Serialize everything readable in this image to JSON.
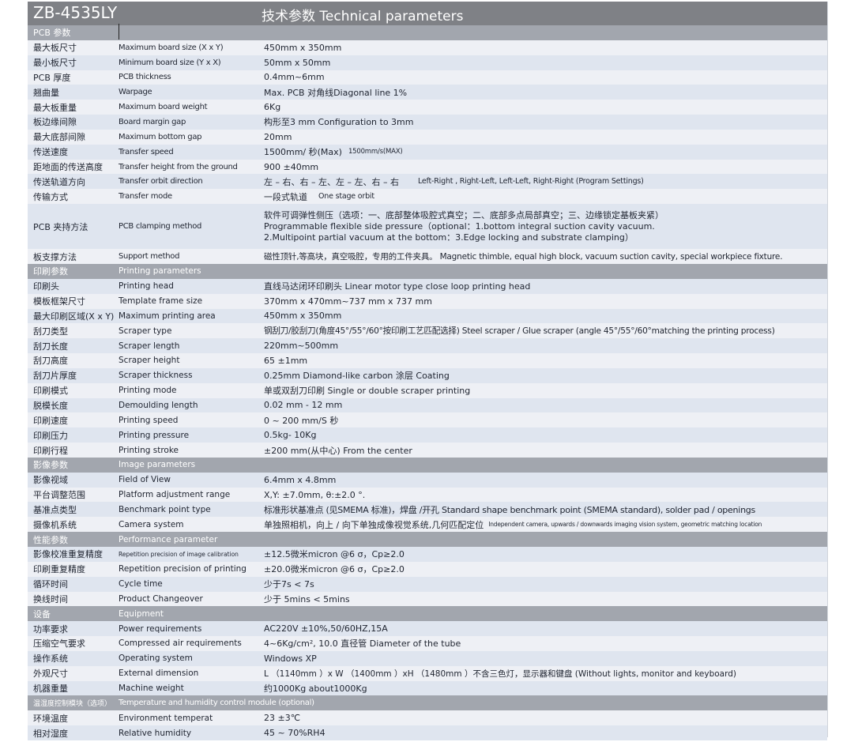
{
  "header": {
    "model": "ZB-4535LY",
    "title": "技术参数  Technical parameters"
  },
  "sections": [
    {
      "label_cn": "PCB 参数",
      "label_en": "",
      "rows": [
        {
          "cn": "最大板尺寸",
          "en": "Maximum board size (X x Y)",
          "value": "450mm x 350mm"
        },
        {
          "cn": "最小板尺寸",
          "en": "Minimum board size (Y x X)",
          "value": "50mm x 50mm"
        },
        {
          "cn": "PCB 厚度",
          "en": "PCB thickness",
          "value": "0.4mm~6mm"
        },
        {
          "cn": "翘曲量",
          "en": "Warpage",
          "value": "Max. PCB  对角线Diagonal line 1%"
        },
        {
          "cn": "最大板重量",
          "en": "Maximum board weight",
          "value": "6Kg"
        },
        {
          "cn": "板边缘间隙",
          "en": "Board margin gap",
          "value": "构形至3 mm  Configuration to 3mm"
        },
        {
          "cn": "最大底部间隙",
          "en": "Maximum bottom gap",
          "value": "20mm"
        },
        {
          "cn": "传送速度",
          "en": "Transfer speed",
          "value": "1500mm/ 秒(Max)",
          "note": "1500mm/s(MAX)"
        },
        {
          "cn": "距地面的传送高度",
          "en": "Transfer height from the ground",
          "value": "900 ±40mm"
        },
        {
          "cn": "传送轨道方向",
          "en": "Transfer orbit direction",
          "value": "左 – 右、右 – 左、左 – 左、右 – 右",
          "note": "Left-Right , Right-Left, Left-Left, Right-Right (Program Settings)"
        },
        {
          "cn": "传输方式",
          "en": "Transfer mode",
          "value": "一段式轨道",
          "note": "One stage orbit"
        },
        {
          "cn": "PCB 夹持方法",
          "en": "PCB clamping method",
          "lines": [
            "软件可调弹性侧压（选项：一、底部整体吸腔式真空；二、底部多点局部真空；三、边缘锁定基板夹紧）",
            "Programmable flexible side pressure（optional：1.bottom integral suction cavity vacuum.",
            "2.Multipoint partial vacuum at the bottom：3.Edge locking and substrate clamping）"
          ]
        },
        {
          "cn": "板支撑方法",
          "en": "Support method",
          "value": "磁性顶针,等高块，真空吸腔，专用的工件夹具。 Magnetic thimble, equal high block, vacuum suction cavity, special workpiece fixture."
        }
      ]
    },
    {
      "label_cn": "印刷参数",
      "label_en": "Printing parameters",
      "rows": [
        {
          "cn": "印刷头",
          "en": "Printing head",
          "value": "直线马达闭环印刷头   Linear motor type close loop printing head"
        },
        {
          "cn": "模板框架尺寸",
          "en": "Template frame size",
          "value": "370mm x 470mm~737 mm x 737 mm"
        },
        {
          "cn": "最大印刷区域(X x Y)",
          "en": "Maximum printing area",
          "value": "450mm x 350mm"
        },
        {
          "cn": "刮刀类型",
          "en": "Scraper type",
          "value": "钢刮刀/胶刮刀(角度45°/55°/60°按印刷工艺匹配选择) Steel scraper / Glue scraper (angle 45°/55°/60°matching the printing process)"
        },
        {
          "cn": "刮刀长度",
          "en": "Scraper length",
          "value": "220mm~500mm"
        },
        {
          "cn": "刮刀高度",
          "en": "Scraper height",
          "value": "65 ±1mm"
        },
        {
          "cn": "刮刀片厚度",
          "en": "Scraper thickness",
          "value": "0.25mm Diamond-like carbon 涂层 Coating"
        },
        {
          "cn": "印刷模式",
          "en": "Printing mode",
          "value": "单或双刮刀印刷  Single or double scraper printing"
        },
        {
          "cn": "脱模长度",
          "en": "Demoulding length",
          "value": "0.02 mm - 12 mm"
        },
        {
          "cn": "印刷速度",
          "en": "Printing speed",
          "value": "0 ~ 200 mm/S 秒"
        },
        {
          "cn": "印刷压力",
          "en": "Printing pressure",
          "value": "0.5kg- 10Kg"
        },
        {
          "cn": "印刷行程",
          "en": "Printing stroke",
          "value": "±200 mm(从中心)  From the center"
        }
      ]
    },
    {
      "label_cn": "影像参数",
      "label_en": "Image parameters",
      "rows": [
        {
          "cn": "影像视域",
          "en": "Field of View",
          "value": "6.4mm x 4.8mm"
        },
        {
          "cn": "平台调整范围",
          "en": "Platform adjustment range",
          "value": "X,Y: ±7.0mm,  θ:±2.0 °."
        },
        {
          "cn": "基准点类型",
          "en": "Benchmark point type",
          "value": "标准形状基准点 (见SMEMA 标准)，焊盘 /开孔 Standard shape benchmark point (SMEMA standard), solder pad / openings"
        },
        {
          "cn": "摄像机系统",
          "en": "Camera system",
          "value": "单独照相机，向上 / 向下单独成像视觉系统,几何匹配定位",
          "note": "Independent camera, upwards / downwards imaging vision system, geometric matching location"
        }
      ]
    },
    {
      "label_cn": "性能参数",
      "label_en": "Performance parameter",
      "rows": [
        {
          "cn": "影像校准重复精度",
          "en": "Repetition precision of image calibration",
          "value": "±12.5微米micron @6 σ，Cp≥2.0"
        },
        {
          "cn": "印刷重复精度",
          "en": "Repetition precision of printing",
          "value": "±20.0微米micron @6 σ，Cp≥2.0"
        },
        {
          "cn": "循环时间",
          "en": "Cycle time",
          "value": "少于7s        < 7s"
        },
        {
          "cn": "换线时间",
          "en": "Product Changeover",
          "value": "少于 5mins   < 5mins"
        }
      ]
    },
    {
      "label_cn": "设备",
      "label_en": "Equipment",
      "rows": [
        {
          "cn": "功率要求",
          "en": "Power requirements",
          "value": "AC220V  ±10%,50/60HZ,15A"
        },
        {
          "cn": "压缩空气要求",
          "en": "Compressed air requirements",
          "value": "4~6Kg/cm², 10.0     直径管 Diameter of the tube"
        },
        {
          "cn": "操作系统",
          "en": "Operating system",
          "value": "Windows XP"
        },
        {
          "cn": "外观尺寸",
          "en": "External dimension",
          "value": "L （1140mm ）x W （1400mm  ）xH （1480mm ）不含三色灯，显示器和键盘  (Without lights, monitor and keyboard)"
        },
        {
          "cn": "机器重量",
          "en": "Machine weight",
          "value": "约1000Kg   about1000Kg"
        }
      ]
    },
    {
      "label_cn": "温湿度控制模块（选项）",
      "label_en": "Temperature and humidity control module (optional)",
      "rows": [
        {
          "cn": "环境温度",
          "en": "Environment temperat",
          "value": "23 ±3℃"
        },
        {
          "cn": "相对湿度",
          "en": "Relative  humidity",
          "value": "45 ~ 70%RH4"
        }
      ]
    }
  ],
  "colors": {
    "header_bg": "#7f8186",
    "section_bg": "#a2a6ae",
    "row_light": "#eef0f5",
    "row_dark": "#dfe5ef",
    "text": "#1f2430"
  }
}
